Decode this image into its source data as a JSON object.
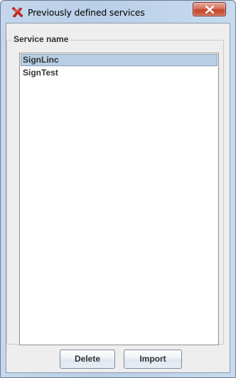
{
  "window": {
    "title": "Previously defined services",
    "icon": "app-x-icon",
    "close_icon": "close-icon"
  },
  "group": {
    "label": "Service name"
  },
  "services": {
    "items": [
      {
        "label": "SignLinc",
        "selected": true
      },
      {
        "label": "SignTest",
        "selected": false
      }
    ]
  },
  "buttons": {
    "delete_label": "Delete",
    "import_label": "Import"
  },
  "colors": {
    "selection_bg": "#b8cfe5",
    "close_red": "#c4442c",
    "frame_blue": "#b9cfe8"
  }
}
